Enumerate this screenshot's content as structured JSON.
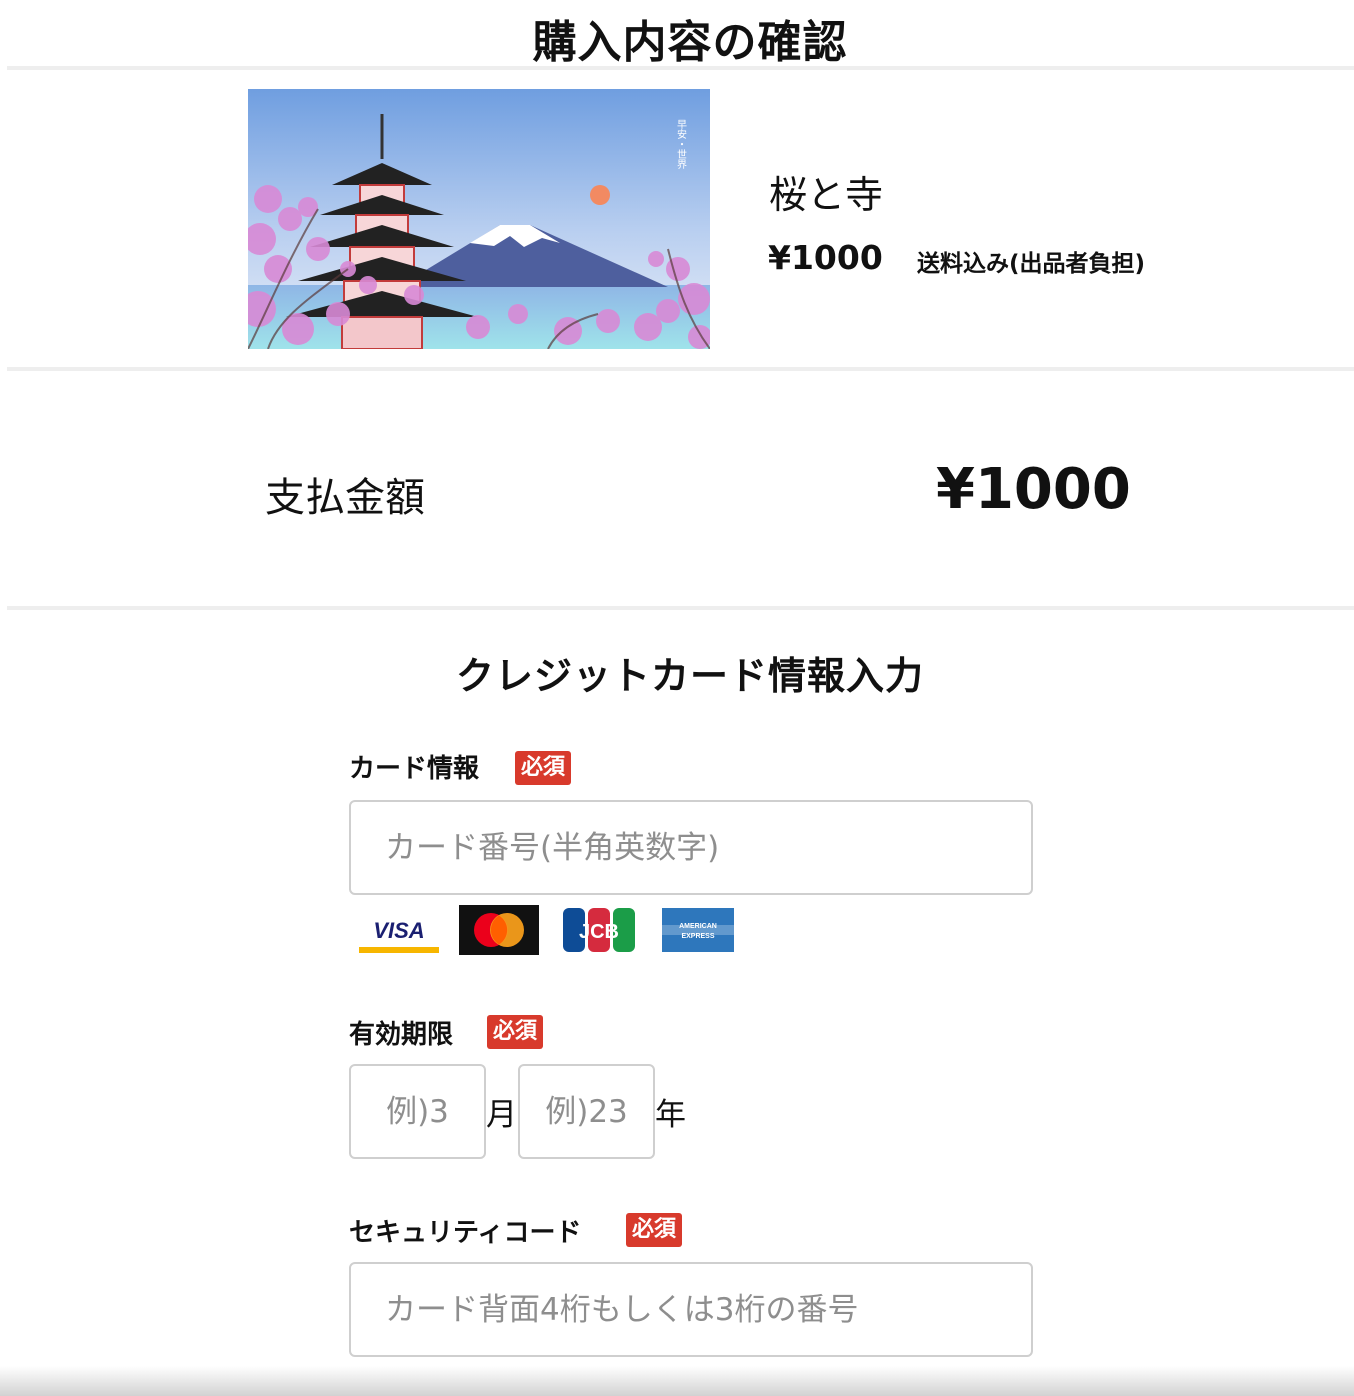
{
  "header": {
    "title": "購入内容の確認"
  },
  "product": {
    "image_caption": "早安・世界",
    "name": "桜と寺",
    "price": "¥1000",
    "shipping_note": "送料込み(出品者負担)"
  },
  "payment": {
    "label": "支払金額",
    "amount": "¥1000"
  },
  "credit_card": {
    "section_title": "クレジットカード情報入力",
    "required_badge": "必須",
    "card_info": {
      "label": "カード情報",
      "placeholder": "カード番号(半角英数字)",
      "brands": [
        {
          "name": "VISA",
          "icon": "visa-icon"
        },
        {
          "name": "Mastercard",
          "icon": "mastercard-icon"
        },
        {
          "name": "JCB",
          "icon": "jcb-icon"
        },
        {
          "name": "AMERICAN EXPRESS",
          "icon": "amex-icon"
        }
      ]
    },
    "expiry": {
      "label": "有効期限",
      "month_placeholder": "例)3",
      "month_unit": "月",
      "year_placeholder": "例)23",
      "year_unit": "年"
    },
    "security_code": {
      "label": "セキュリティコード",
      "placeholder": "カード背面4桁もしくは3桁の番号"
    }
  },
  "colors": {
    "required_badge": "#d83a2c",
    "divider": "#eeeeee",
    "input_border": "#cfcfcf",
    "placeholder": "#8e8e8e",
    "visa_blue": "#1a1f71",
    "visa_gold": "#f7b600",
    "mastercard_red": "#eb001b",
    "mastercard_orange": "#f79e1b",
    "amex_blue": "#2e77bc"
  }
}
